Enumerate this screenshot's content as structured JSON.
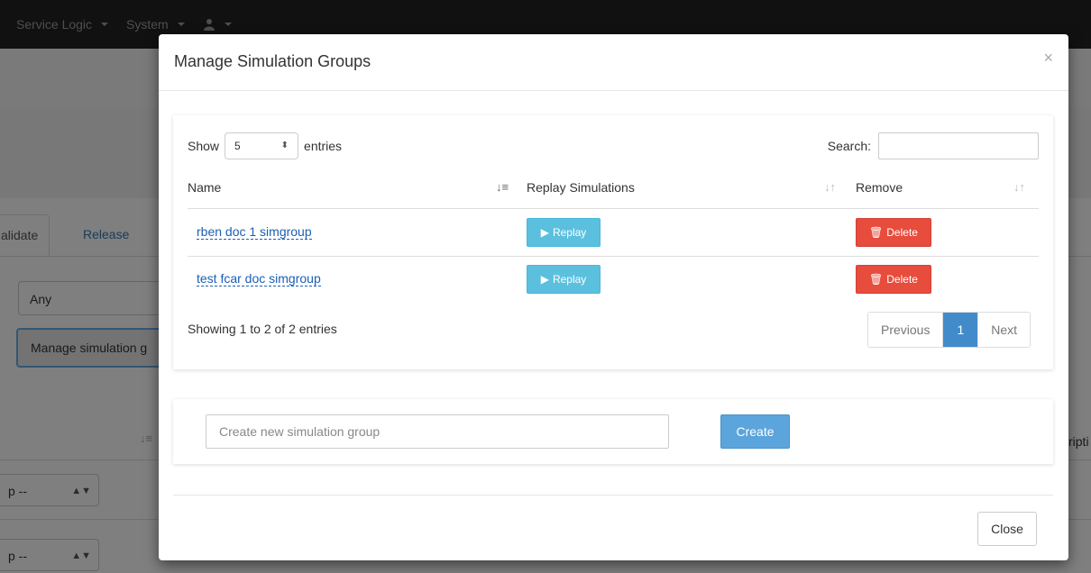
{
  "background": {
    "nav": [
      {
        "label": "Service Logic"
      },
      {
        "label": "System"
      },
      {
        "label": ""
      }
    ],
    "tabs": [
      "alidate",
      "Release"
    ],
    "filter_value": "Any",
    "manage_button_label": "Manage simulation g",
    "row_select_label": "p --",
    "right_text": "ripti"
  },
  "modal": {
    "title": "Manage Simulation Groups",
    "close_glyph": "×",
    "table": {
      "show_label": "Show",
      "entries_label": "entries",
      "page_length": "5",
      "search_label": "Search:",
      "search_value": "",
      "columns": [
        "Name",
        "Replay Simulations",
        "Remove"
      ],
      "rows": [
        {
          "name": "rben doc 1 simgroup",
          "replay_label": "Replay",
          "delete_label": "Delete"
        },
        {
          "name": "test fcar doc simgroup",
          "replay_label": "Replay",
          "delete_label": "Delete"
        }
      ],
      "info": "Showing 1 to 2 of 2 entries",
      "pagination": {
        "previous": "Previous",
        "current": "1",
        "next": "Next"
      }
    },
    "create": {
      "placeholder": "Create new simulation group",
      "button_label": "Create"
    },
    "footer": {
      "close_label": "Close"
    }
  },
  "colors": {
    "navbar": "#222222",
    "replay": "#5bc0de",
    "delete": "#e74c3c",
    "primary": "#5ba4dc",
    "link": "#1a5fb4"
  },
  "icons": {
    "replay": "play-icon",
    "delete": "trash-icon",
    "sort_active": "sort-asc-icon",
    "sort": "sort-icon",
    "user": "user-icon"
  }
}
